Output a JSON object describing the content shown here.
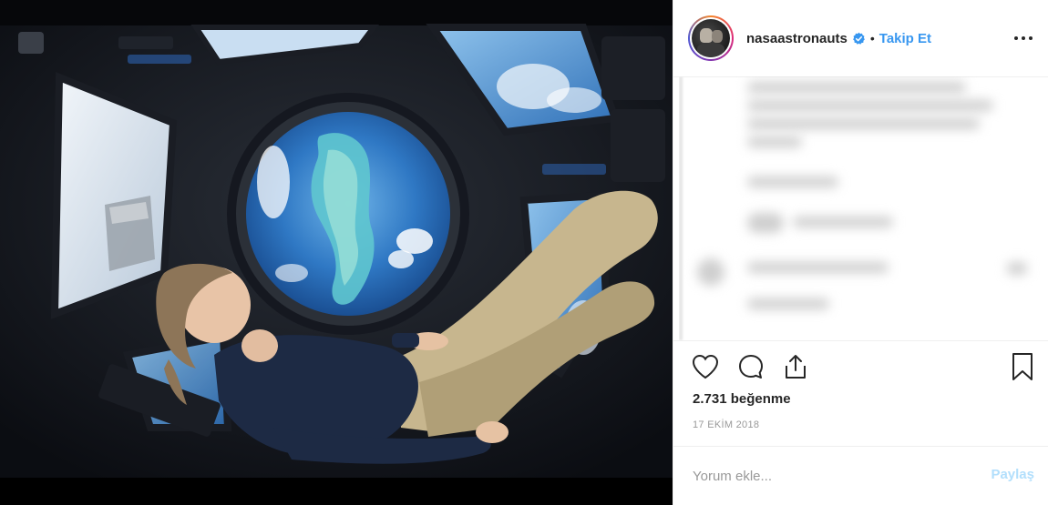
{
  "post": {
    "username": "nasaastronauts",
    "separator": "•",
    "follow_label": "Takip Et",
    "likes_text": "2.731 beğenme",
    "date_text": "17 EKİM 2018",
    "comment_placeholder": "Yorum ekle...",
    "post_label": "Paylaş"
  },
  "icons": {
    "verified": "verified-badge-icon",
    "more": "more-options-icon",
    "like": "heart-icon",
    "comment": "comment-bubble-icon",
    "share": "share-icon",
    "save": "bookmark-icon"
  },
  "colors": {
    "accent": "#3897f0",
    "post_disabled": "#b2dffc",
    "text": "#262626",
    "muted": "#999999"
  }
}
